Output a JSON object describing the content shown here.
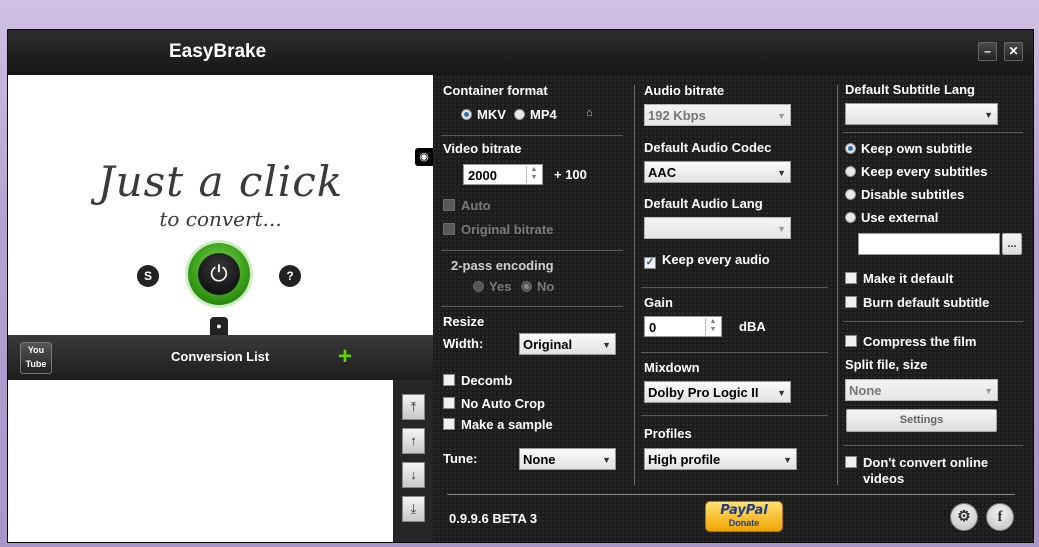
{
  "app": {
    "title": "EasyBrake",
    "minimize": "–",
    "close": "✕"
  },
  "hero": {
    "line1": "Just a click",
    "line2": "to convert...",
    "power_icon": "⏻",
    "left_icon": "S",
    "right_icon": "?",
    "drop_icon": "●",
    "side_tab_icon": "◉"
  },
  "list": {
    "title": "Conversion List",
    "youtube_label_1": "You",
    "youtube_label_2": "Tube",
    "add_icon": "+",
    "arrows": {
      "top": "⤒",
      "up": "↑",
      "down": "↓",
      "bottom": "⤓"
    }
  },
  "col1": {
    "container_format": "Container format",
    "mkv": "MKV",
    "mp4": "MP4",
    "video_bitrate": "Video bitrate",
    "bitrate_value": "2000",
    "plus": "+ 100",
    "auto": "Auto",
    "original_bitrate": "Original bitrate",
    "two_pass": "2-pass encoding",
    "yes": "Yes",
    "no": "No",
    "resize": "Resize",
    "width_label": "Width:",
    "width_value": "Original",
    "decomb": "Decomb",
    "no_auto_crop": "No Auto Crop",
    "make_sample": "Make a sample",
    "tune_label": "Tune:",
    "tune_value": "None"
  },
  "col2": {
    "audio_bitrate": "Audio bitrate",
    "audio_bitrate_value": "192 Kbps",
    "default_audio_codec": "Default Audio Codec",
    "codec_value": "AAC",
    "default_audio_lang": "Default Audio Lang",
    "audio_lang_value": "",
    "keep_every_audio": "Keep every audio",
    "gain": "Gain",
    "gain_value": "0",
    "gain_unit": "dBA",
    "mixdown": "Mixdown",
    "mixdown_value": "Dolby Pro Logic II",
    "profiles": "Profiles",
    "profiles_value": "High profile"
  },
  "col3": {
    "default_subtitle_lang": "Default Subtitle Lang",
    "subtitle_lang_value": "",
    "keep_own": "Keep own subtitle",
    "keep_every": "Keep every subtitles",
    "disable": "Disable subtitles",
    "use_external": "Use external",
    "external_value": "",
    "browse": "...",
    "make_default": "Make it default",
    "burn_default": "Burn default subtitle",
    "compress": "Compress the film",
    "split": "Split file, size",
    "split_value": "None",
    "settings": "Settings",
    "dont_convert": "Don't convert online",
    "dont_convert_2": "videos"
  },
  "footer": {
    "version": "0.9.9.6 BETA 3",
    "paypal": "PayPal",
    "donate": "Donate",
    "steam_icon": "⚙",
    "facebook_icon": "f"
  }
}
